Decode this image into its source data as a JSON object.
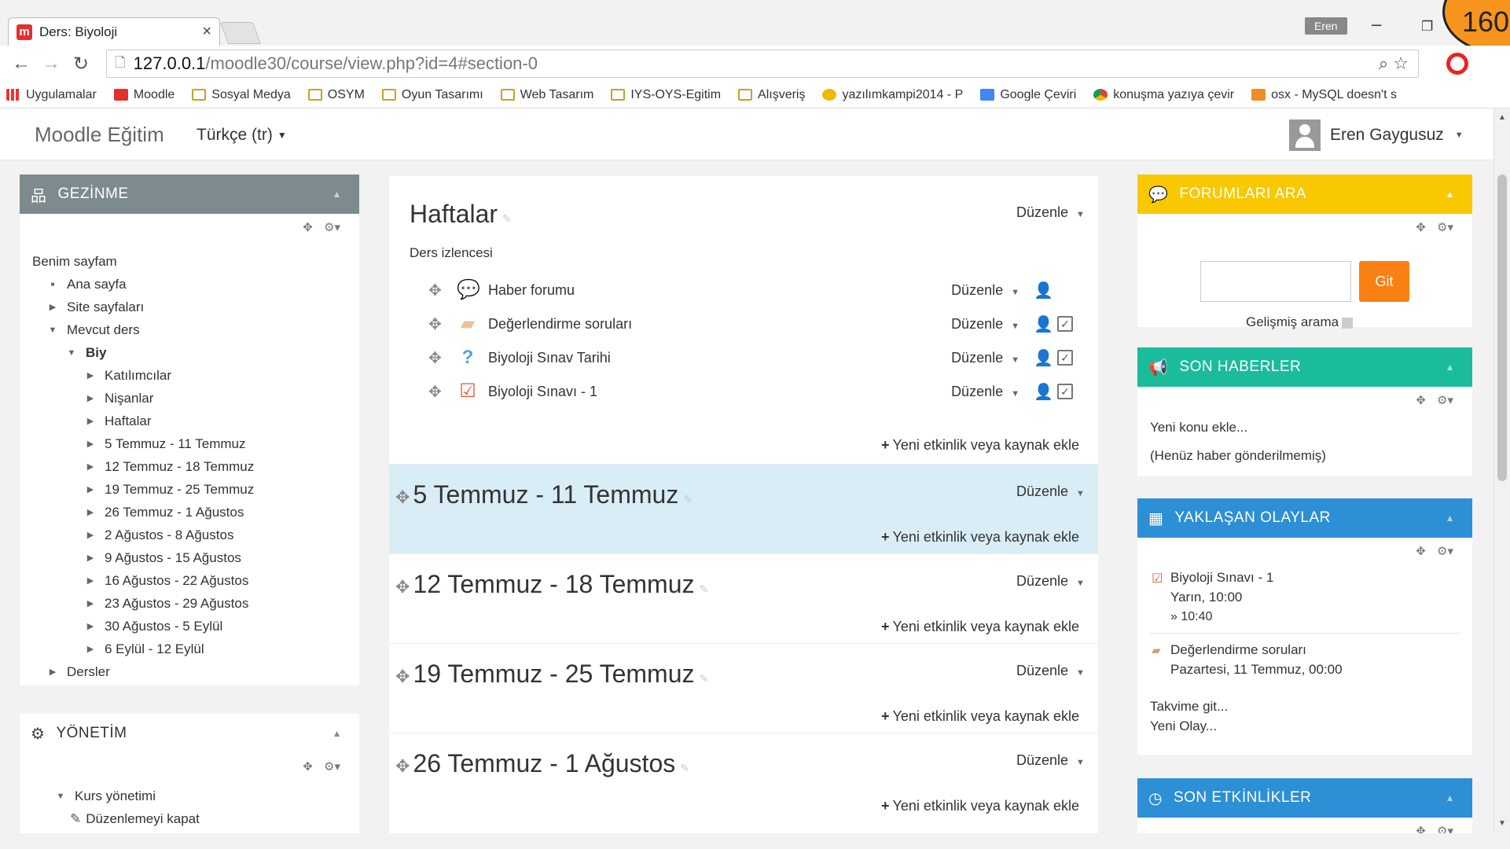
{
  "browser": {
    "tab_title": "Ders: Biyoloji",
    "tab_close": "×",
    "profile_name": "Eren",
    "win_minimize": "–",
    "win_restore": "❐",
    "badge_number": "160",
    "url_host": "127.0.0.1",
    "url_path": "/moodle30/course/view.php?id=4#section-0",
    "bookmarks": [
      {
        "label": "Uygulamalar",
        "icon": "apps-icon"
      },
      {
        "label": "Moodle",
        "icon": "moodle-icon"
      },
      {
        "label": "Sosyal Medya",
        "icon": "folder-icon"
      },
      {
        "label": "OSYM",
        "icon": "folder-icon"
      },
      {
        "label": "Oyun Tasarımı",
        "icon": "folder-icon"
      },
      {
        "label": "Web Tasarım",
        "icon": "folder-icon"
      },
      {
        "label": "IYS-OYS-Egitim",
        "icon": "folder-icon"
      },
      {
        "label": "Alışveriş",
        "icon": "folder-icon"
      },
      {
        "label": "yazılımkampi2014 - P",
        "icon": "yazilim-icon"
      },
      {
        "label": "Google Çeviri",
        "icon": "translate-icon"
      },
      {
        "label": "konuşma yazıya çevir",
        "icon": "chrome-icon"
      },
      {
        "label": "osx - MySQL doesn't s",
        "icon": "stack-icon"
      }
    ]
  },
  "navbar": {
    "brand": "Moodle Eğitim",
    "language": "Türkçe (tr)",
    "user_name": "Eren Gaygusuz"
  },
  "gezinme": {
    "title": "GEZİNME",
    "items": [
      {
        "label": "Benim sayfam",
        "marker": "none",
        "level": 0
      },
      {
        "label": "Ana sayfa",
        "marker": "bullet",
        "level": 1
      },
      {
        "label": "Site sayfaları",
        "marker": "right",
        "level": 1
      },
      {
        "label": "Mevcut ders",
        "marker": "down",
        "level": 1
      },
      {
        "label": "Biy",
        "marker": "down",
        "level": 2
      },
      {
        "label": "Katılımcılar",
        "marker": "right",
        "level": 3
      },
      {
        "label": "Nişanlar",
        "marker": "right",
        "level": 3
      },
      {
        "label": "Haftalar",
        "marker": "right",
        "level": 3
      },
      {
        "label": "5 Temmuz - 11 Temmuz",
        "marker": "right",
        "level": 3
      },
      {
        "label": "12 Temmuz - 18 Temmuz",
        "marker": "right",
        "level": 3
      },
      {
        "label": "19 Temmuz - 25 Temmuz",
        "marker": "right",
        "level": 3
      },
      {
        "label": "26 Temmuz - 1 Ağustos",
        "marker": "right",
        "level": 3
      },
      {
        "label": "2 Ağustos - 8 Ağustos",
        "marker": "right",
        "level": 3
      },
      {
        "label": "9 Ağustos - 15 Ağustos",
        "marker": "right",
        "level": 3
      },
      {
        "label": "16 Ağustos - 22 Ağustos",
        "marker": "right",
        "level": 3
      },
      {
        "label": "23 Ağustos - 29 Ağustos",
        "marker": "right",
        "level": 3
      },
      {
        "label": "30 Ağustos - 5 Eylül",
        "marker": "right",
        "level": 3
      },
      {
        "label": "6 Eylül - 12 Eylül",
        "marker": "right",
        "level": 3
      },
      {
        "label": "Dersler",
        "marker": "right",
        "level": 1
      }
    ]
  },
  "yonetim": {
    "title": "YÖNETİM",
    "items": [
      {
        "label": "Kurs yönetimi",
        "marker": "down"
      },
      {
        "label": "Düzenlemeyi kapat",
        "marker": "pencil"
      }
    ]
  },
  "course": {
    "section0_title": "Haftalar",
    "edit_label": "Düzenle",
    "summary": "Ders izlencesi",
    "add_label": "Yeni etkinlik veya kaynak ekle",
    "activities": [
      {
        "name": "Haber forumu",
        "icon": "forum-icon",
        "color": "#7cc576",
        "checkbox": false
      },
      {
        "name": "Değerlendirme soruları",
        "icon": "feedback-icon",
        "color": "#e8c596",
        "checkbox": true
      },
      {
        "name": "Biyoloji Sınav Tarihi",
        "icon": "question-icon",
        "color": "#5aa0e0",
        "checkbox": true
      },
      {
        "name": "Biyoloji Sınavı - 1",
        "icon": "quiz-icon",
        "color": "#e05a2a",
        "checkbox": true
      }
    ],
    "weeks": [
      {
        "title": "5 Temmuz - 11 Temmuz",
        "current": true
      },
      {
        "title": "12 Temmuz - 18 Temmuz",
        "current": false
      },
      {
        "title": "19 Temmuz - 25 Temmuz",
        "current": false
      },
      {
        "title": "26 Temmuz - 1 Ağustos",
        "current": false
      }
    ]
  },
  "forum_search": {
    "title": "FORUMLARI ARA",
    "button": "Git",
    "advanced": "Gelişmiş arama"
  },
  "news": {
    "title": "SON HABERLER",
    "add_topic": "Yeni konu ekle...",
    "empty": "(Henüz haber gönderilmemiş)"
  },
  "events": {
    "title": "YAKLAŞAN OLAYLAR",
    "event1_name": "Biyoloji Sınavı - 1",
    "event1_date": "Yarın, 10:00",
    "event1_time": "» 10:40",
    "event2_name": "Değerlendirme soruları",
    "event2_date": "Pazartesi, 11 Temmuz, 00:00",
    "goto_calendar": "Takvime git...",
    "new_event": "Yeni Olay..."
  },
  "recent": {
    "title": "SON ETKİNLİKLER"
  },
  "colors": {
    "moodle_orange": "#f98012",
    "yellow_block": "#f9c800",
    "green_block": "#1abc9c",
    "blue_block": "#2d8fd5",
    "gray_block": "#7d8a8e",
    "current_week": "#d9edf7"
  }
}
